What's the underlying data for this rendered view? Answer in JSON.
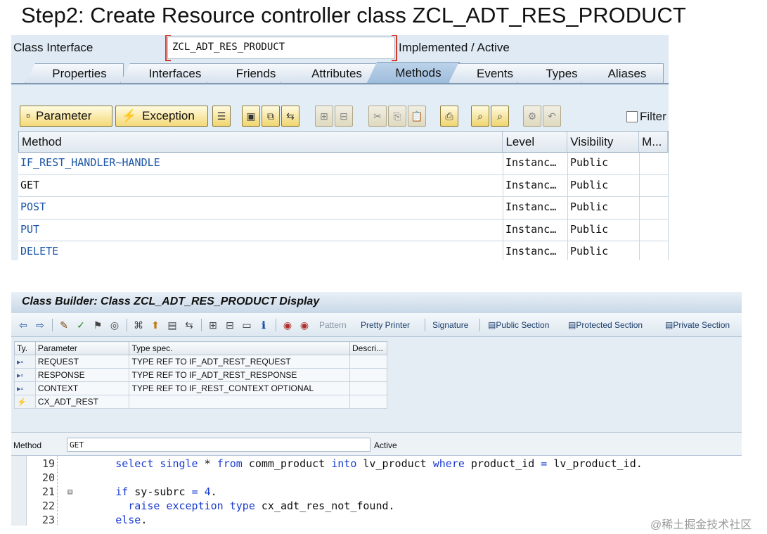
{
  "slide": {
    "title": "Step2: Create Resource controller class ZCL_ADT_RES_PRODUCT"
  },
  "top": {
    "class_interface_label": "Class Interface",
    "class_interface_value": "ZCL_ADT_RES_PRODUCT",
    "status": "Implemented / Active",
    "tabs": [
      "Properties",
      "Interfaces",
      "Friends",
      "Attributes",
      "Methods",
      "Events",
      "Types",
      "Aliases"
    ],
    "active_tab": "Methods",
    "toolbar": {
      "parameter_label": "Parameter",
      "exception_label": "Exception",
      "filter_label": "Filter"
    },
    "columns": [
      "Method",
      "Level",
      "Visibility",
      "M..."
    ],
    "rows": [
      {
        "method": "IF_REST_HANDLER~HANDLE",
        "level": "Instanc…",
        "visibility": "Public"
      },
      {
        "method": "GET",
        "level": "Instanc…",
        "visibility": "Public"
      },
      {
        "method": "POST",
        "level": "Instanc…",
        "visibility": "Public"
      },
      {
        "method": "PUT",
        "level": "Instanc…",
        "visibility": "Public"
      },
      {
        "method": "DELETE",
        "level": "Instanc…",
        "visibility": "Public"
      }
    ]
  },
  "bottom": {
    "title": "Class Builder: Class ZCL_ADT_RES_PRODUCT Display",
    "toolbar": {
      "pattern": "Pattern",
      "pretty_printer": "Pretty Printer",
      "signature": "Signature",
      "public_section": "Public Section",
      "protected_section": "Protected Section",
      "private_section": "Private Section"
    },
    "param_columns": [
      "Ty.",
      "Parameter",
      "Type spec.",
      "Descri..."
    ],
    "params": [
      {
        "name": "REQUEST",
        "type_spec": "TYPE REF TO IF_ADT_REST_REQUEST"
      },
      {
        "name": "RESPONSE",
        "type_spec": "TYPE REF TO IF_ADT_REST_RESPONSE"
      },
      {
        "name": "CONTEXT",
        "type_spec": "TYPE REF TO IF_REST_CONTEXT OPTIONAL"
      },
      {
        "name": "CX_ADT_REST",
        "type_spec": ""
      }
    ],
    "method_label": "Method",
    "method_value": "GET",
    "method_status": "Active",
    "code": {
      "line_numbers": [
        "19",
        "20",
        "21",
        "22",
        "23"
      ],
      "l19": {
        "indent": "      ",
        "k1": "select single",
        "t1": " * ",
        "k2": "from",
        "t2": " comm_product ",
        "k3": "into",
        "t3": " lv_product ",
        "k4": "where",
        "t4": " product_id ",
        "k5": "=",
        "t5": " lv_product_id."
      },
      "l21": {
        "indent": "      ",
        "k1": "if",
        "t1": " sy-subrc ",
        "k2": "=",
        "t2": " ",
        "k3": "4",
        "t3": "."
      },
      "l22": {
        "indent": "        ",
        "k1": "raise exception type",
        "t1": " cx_adt_res_not_found."
      },
      "l23": {
        "indent": "      ",
        "k1": "else",
        "t1": "."
      }
    }
  },
  "watermark": "@稀土掘金技术社区"
}
